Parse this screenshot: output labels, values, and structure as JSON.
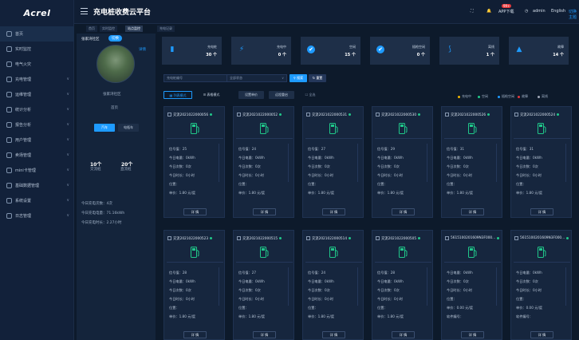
{
  "app": {
    "logo": "Acrel",
    "title": "充电桩收费云平台"
  },
  "header": {
    "app_download": "APP下载",
    "badge": "99+",
    "user": "admin",
    "lang_en": "English",
    "lang_cn": "切换主题"
  },
  "sidebar": {
    "items": [
      {
        "label": "首页",
        "icon": "home-icon"
      },
      {
        "label": "实时监控",
        "icon": "monitor-icon"
      },
      {
        "label": "电气火灾",
        "icon": "fire-icon"
      },
      {
        "label": "充电管理",
        "icon": "charge-icon"
      },
      {
        "label": "运维管理",
        "icon": "tool-icon"
      },
      {
        "label": "统计分析",
        "icon": "bar-chart-icon"
      },
      {
        "label": "报告分析",
        "icon": "report-icon"
      },
      {
        "label": "用户管理",
        "icon": "user-icon"
      },
      {
        "label": "卖场管理",
        "icon": "store-icon"
      },
      {
        "label": "mini卡管理",
        "icon": "card-icon"
      },
      {
        "label": "基础数据管理",
        "icon": "database-icon"
      },
      {
        "label": "系统设置",
        "icon": "gear-icon"
      },
      {
        "label": "日志管理",
        "icon": "log-icon"
      }
    ]
  },
  "tabs": [
    "首页",
    "实时监控",
    "站点监控",
    "充电记录"
  ],
  "station": {
    "name": "张家湾社区",
    "tag": "切换",
    "link": "详情",
    "caption": "张家湾社区",
    "sub": "首页",
    "btn_car": "汽车",
    "btn_ebike": "电瓶车",
    "stat1_val": "10个",
    "stat1_label": "交流桩",
    "stat2_val": "20个",
    "stat2_label": "直流桩",
    "today_count": "今日充电次数：4次",
    "today_energy": "今日充电电量：71.16kWh",
    "today_time": "今日充电时长：2.27小时"
  },
  "summary": [
    {
      "label": "充电桩",
      "value": "30 个",
      "icon": "charger-icon",
      "color": "#1e9bff"
    },
    {
      "label": "充电中",
      "value": "0 个",
      "icon": "lightning-icon",
      "color": "#1e9bff"
    },
    {
      "label": "空闲",
      "value": "15 个",
      "icon": "check-circle-icon",
      "color": "#1e9bff"
    },
    {
      "label": "插枪空闲",
      "value": "0 个",
      "icon": "check-circle-icon",
      "color": "#1e9bff"
    },
    {
      "label": "离线",
      "value": "1 个",
      "icon": "plug-icon",
      "color": "#1e9bff"
    },
    {
      "label": "故障",
      "value": "14 个",
      "icon": "warning-icon",
      "color": "#1e9bff"
    }
  ],
  "filter": {
    "placeholder": "充电桩编号",
    "status": "全部状态",
    "search": "搜索",
    "reset": "重置"
  },
  "view": {
    "list_mode": "列表模式",
    "table_mode": "表格模式",
    "price": "设置单价",
    "remote": "远程重启",
    "select_all": "全选"
  },
  "legend": [
    {
      "label": "充电中",
      "color": "#f0b400"
    },
    {
      "label": "空闲",
      "color": "#20c88a"
    },
    {
      "label": "插枪空闲",
      "color": "#1e9bff"
    },
    {
      "label": "故障",
      "color": "#e4393c"
    },
    {
      "label": "离线",
      "color": "#a0a8b8"
    }
  ],
  "cards": [
    {
      "title": "交流2021022000056",
      "lines": [
        "信号值：25",
        "今日电量：0kWh",
        "今日次数：0次",
        "今日时长：0小时",
        "位置：",
        "单价：1.80 元/度"
      ],
      "action": "详 情"
    },
    {
      "title": "交流2021022000052",
      "lines": [
        "信号值：24",
        "今日电量：0kWh",
        "今日次数：0次",
        "今日时长：0小时",
        "位置：",
        "单价：1.80 元/度"
      ],
      "action": "详 情"
    },
    {
      "title": "交流2021022000531",
      "lines": [
        "信号值：27",
        "今日电量：0kWh",
        "今日次数：0次",
        "今日时长：0小时",
        "位置：",
        "单价：1.80 元/度"
      ],
      "action": "详 情"
    },
    {
      "title": "交流2021022000530",
      "lines": [
        "信号值：29",
        "今日电量：0kWh",
        "今日次数：0次",
        "今日时长：0小时",
        "位置：",
        "单价：1.80 元/度"
      ],
      "action": "详 情"
    },
    {
      "title": "交流2021022000526",
      "lines": [
        "信号值：31",
        "今日电量：0kWh",
        "今日次数：0次",
        "今日时长：0小时",
        "位置：",
        "单价：1.80 元/度"
      ],
      "action": "详 情"
    },
    {
      "title": "交流2021022000524",
      "lines": [
        "信号值：31",
        "今日电量：0kWh",
        "今日次数：0次",
        "今日时长：0小时",
        "位置：",
        "单价：1.80 元/度"
      ],
      "action": "详 情"
    },
    {
      "title": "交流2021022000523",
      "lines": [
        "信号值：28",
        "今日电量：0kWh",
        "今日次数：0次",
        "今日时长：0小时",
        "位置：",
        "单价：1.80 元/度"
      ],
      "action": "详 情"
    },
    {
      "title": "交流2021022000515",
      "lines": [
        "信号值：27",
        "今日电量：0kWh",
        "今日次数：0次",
        "今日时长：0小时",
        "位置：",
        "单价：1.80 元/度"
      ],
      "action": "详 情"
    },
    {
      "title": "交流2021022000514",
      "lines": [
        "信号值：24",
        "今日电量：0kWh",
        "今日次数：0次",
        "今日时长：0小时",
        "位置：",
        "单价：1.80 元/度"
      ],
      "action": "详 情"
    },
    {
      "title": "交流2021022000505",
      "lines": [
        "信号值：28",
        "今日电量：0kWh",
        "今日次数：0次",
        "今日时长：0小时",
        "位置：",
        "单价：1.80 元/度"
      ],
      "action": "详 情"
    },
    {
      "title": "5615100201609N3F000...",
      "lines": [
        "今日电量：0kWh",
        "今日次数：0次",
        "今日时长：0小时",
        "位置：",
        "单价：0.00 元/度",
        "软件编号："
      ],
      "action": "详 情"
    },
    {
      "title": "5615100201609N3F000...",
      "lines": [
        "今日电量：0kWh",
        "今日次数：0次",
        "今日时长：0小时",
        "位置：",
        "单价：0.00 元/度",
        "软件编号："
      ],
      "action": "详 情"
    }
  ]
}
